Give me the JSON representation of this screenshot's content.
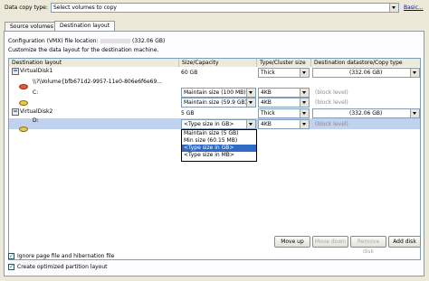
{
  "top": {
    "copy_type_label": "Data copy type:",
    "copy_type_value": "Select volumes to copy",
    "basic_link": "Basic..."
  },
  "tabs": [
    {
      "label": "Source volumes",
      "active": false
    },
    {
      "label": "Destination layout",
      "active": true
    }
  ],
  "config": {
    "file_location_label": "Configuration (VMX) file location:",
    "file_location_size": "(332.06 GB)",
    "customize_text": "Customize the data layout for the destination machine."
  },
  "table": {
    "headers": [
      "Destination layout",
      "Size/Capacity",
      "Type/Cluster size",
      "Destination datastore/Copy type"
    ],
    "rows": [
      {
        "name": "VirtualDisk1",
        "size": "60 GB",
        "type": "Thick",
        "dest": "(332.06 GB)"
      },
      {
        "name": "\\\\?\\Volume{bfb671d2-9957-11e0-806e6f6e69...",
        "size": "Maintain size (100 MB)",
        "type": "4KB",
        "dest": "(block level)"
      },
      {
        "name": "C:",
        "size": "Maintain size (59.9 GB)",
        "type": "4KB",
        "dest": "(block level)"
      },
      {
        "name": "VirtualDisk2",
        "size": "5 GB",
        "type": "Thick",
        "dest": "(332.06 GB)"
      },
      {
        "name": "D:",
        "size": "<Type size in GB>",
        "type": "4KB",
        "dest": "(block level)"
      }
    ],
    "dropdown_options": [
      "Maintain size (5 GB)",
      "Min size (60.15 MB)",
      "<Type size in GB>",
      "<Type size in MB>"
    ],
    "dropdown_selected_index": 2
  },
  "buttons": {
    "move_up": "Move up",
    "move_down": "Move down",
    "remove_disk": "Remove disk",
    "add_disk": "Add disk"
  },
  "options": {
    "ignore_page": {
      "label": "Ignore page file and hibernation file",
      "checked": true
    },
    "optimized": {
      "label": "Create optimized partition layout",
      "checked": true
    }
  },
  "colors": {
    "selection": "#316ac5",
    "selected_row": "#c1d2ee",
    "link": "#0000cc",
    "window_bg": "#ece9d8"
  }
}
